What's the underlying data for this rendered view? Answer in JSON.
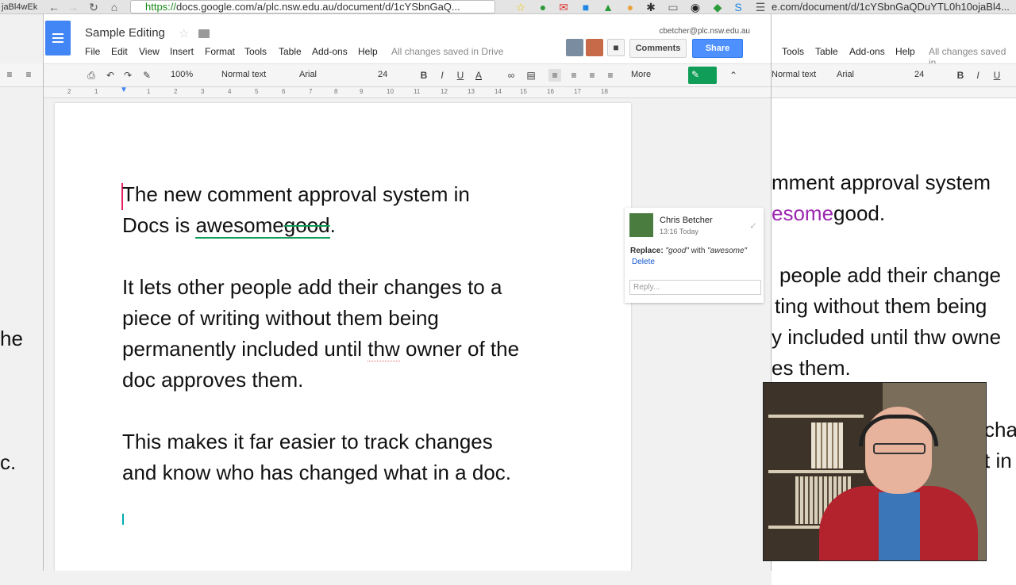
{
  "browser": {
    "url_scheme": "https://",
    "url_rest": "docs.google.com/a/plc.nsw.edu.au/document/d/1cYSbnGaQ...",
    "bg_url": "e.com/document/d/1cYSbnGaQDuYTL0h10ojaBl4...",
    "left_tab_fragment": "jaBl4wEk"
  },
  "header": {
    "title": "Sample Editing",
    "email": "cbetcher@plc.nsw.edu.au",
    "saved_status": "All changes saved in Drive",
    "comments_label": "Comments",
    "share_label": "Share",
    "menu": [
      "File",
      "Edit",
      "View",
      "Insert",
      "Format",
      "Tools",
      "Table",
      "Add-ons",
      "Help"
    ]
  },
  "toolbar": {
    "zoom": "100%",
    "style": "Normal text",
    "font": "Arial",
    "size": "24",
    "more": "More"
  },
  "ruler": [
    "2",
    "1",
    "1",
    "1",
    "2",
    "3",
    "4",
    "5",
    "6",
    "7",
    "8",
    "9",
    "10",
    "11",
    "12",
    "13",
    "14",
    "15",
    "16",
    "17",
    "18"
  ],
  "document": {
    "p1_line1": "The new comment approval system in",
    "p1_docs_is": "Docs is ",
    "p1_inserted": "awesome",
    "p1_deleted": "good",
    "p1_period": ".",
    "p2_line1": "It lets other people add their changes to a",
    "p2_line2": "piece of writing without them being",
    "p2_line3_a": "permanently included until ",
    "p2_typo": "thw",
    "p2_line3_b": " owner of the",
    "p2_line4": "doc approves them.",
    "p3_line1": "This makes it far easier to track changes",
    "p3_line2": "and know who has changed what in a doc."
  },
  "comment": {
    "author": "Chris Betcher",
    "time": "13:16 Today",
    "replace_label": "Replace:",
    "old": "\"good\"",
    "with": " with ",
    "new": "\"awesome\"",
    "delete_label": "Delete",
    "reply_placeholder": "Reply..."
  },
  "background_window": {
    "menu": [
      "Tools",
      "Table",
      "Add-ons",
      "Help"
    ],
    "saved": "All changes saved in",
    "style": "Normal text",
    "font": "Arial",
    "size": "24",
    "line1": "mment approval system",
    "line2_ins": "esome",
    "line2_del": "good.",
    "line3": "people add their change",
    "line4": "ting without them being",
    "line5": "y included until thw owne",
    "line6": "es them.",
    "line7": "cha",
    "line8": "t in"
  },
  "left_fragments": {
    "a": "he",
    "b": "c."
  },
  "colors": {
    "accent": "#4285f4",
    "suggest_green": "#0f9d58",
    "share_blue": "#4d90fe"
  }
}
